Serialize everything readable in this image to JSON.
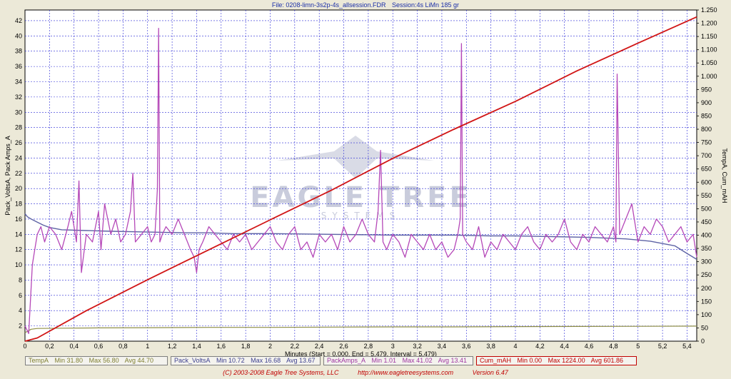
{
  "title": {
    "file": "File: 0208-limn-3s2p-4s_allsession.FDR",
    "session": "Session:4s LiMn 185 gr"
  },
  "colors": {
    "plot_bg": "#ffffff",
    "grid": "#2b2bd6",
    "temp": "#8f8f46",
    "volts": "#5e63a5",
    "amps": "#b548b8",
    "mah": "#d11515",
    "watermark": "#c9ccdc"
  },
  "chart_data": {
    "type": "line",
    "title": "",
    "xlabel": "Minutes (Start = 0.000, End = 5.479, Interval = 5.479)",
    "ylabel": "Pack_VoltsA, Pack Amps_A",
    "y2label": "TempA, Cum_mAH",
    "xlim": [
      0,
      5.479
    ],
    "ylim": [
      0,
      43.4
    ],
    "y2lim": [
      0,
      1250
    ],
    "grid": true,
    "x_ticks": [
      "0",
      "0,2",
      "0,4",
      "0,6",
      "0,8",
      "1",
      "1,2",
      "1,4",
      "1,6",
      "1,8",
      "2",
      "2,2",
      "2,4",
      "2,6",
      "2,8",
      "3",
      "3,2",
      "3,4",
      "3,6",
      "3,8",
      "4",
      "4,2",
      "4,4",
      "4,6",
      "4,8",
      "5",
      "5,2",
      "5,4"
    ],
    "y_ticks": [
      "2",
      "4",
      "6",
      "8",
      "10",
      "12",
      "14",
      "16",
      "18",
      "20",
      "22",
      "24",
      "26",
      "28",
      "30",
      "32",
      "34",
      "36",
      "38",
      "40",
      "42"
    ],
    "y2_ticks": [
      "0",
      "50",
      "100",
      "150",
      "200",
      "250",
      "300",
      "350",
      "400",
      "450",
      "500",
      "550",
      "600",
      "650",
      "700",
      "750",
      "800",
      "850",
      "900",
      "950",
      "1.000",
      "1.050",
      "1.100",
      "1.150",
      "1.200",
      "1.250"
    ],
    "series": [
      {
        "name": "TempA",
        "axis": "right",
        "x": [
          0,
          0.03,
          0.05,
          0.1,
          0.3,
          0.6,
          1,
          1.5,
          2,
          2.5,
          3,
          3.5,
          4,
          4.5,
          5,
          5.479
        ],
        "values": [
          32,
          40,
          45,
          48,
          49,
          50,
          51,
          52,
          52,
          53,
          54,
          54,
          55,
          55.5,
          56,
          56.8
        ]
      },
      {
        "name": "Pack_VoltsA",
        "axis": "left",
        "x": [
          0,
          0.02,
          0.05,
          0.1,
          0.15,
          0.2,
          0.3,
          0.5,
          0.7,
          1,
          1.3,
          1.5,
          1.7,
          2,
          2.5,
          3,
          3.5,
          3.8,
          4,
          4.3,
          4.6,
          4.9,
          5.1,
          5.3,
          5.4,
          5.479
        ],
        "values": [
          16.7,
          16.3,
          16,
          15.6,
          15.2,
          14.9,
          14.6,
          14.5,
          14.4,
          14.3,
          14.2,
          14.2,
          14.1,
          14.1,
          14,
          13.9,
          13.9,
          13.8,
          13.8,
          13.7,
          13.6,
          13.4,
          13.1,
          12.5,
          11.5,
          10.72
        ]
      },
      {
        "name": "PackAmps_A",
        "axis": "left",
        "x": [
          0,
          0.03,
          0.06,
          0.08,
          0.1,
          0.13,
          0.16,
          0.2,
          0.25,
          0.3,
          0.35,
          0.38,
          0.42,
          0.44,
          0.46,
          0.5,
          0.55,
          0.6,
          0.62,
          0.65,
          0.7,
          0.74,
          0.78,
          0.82,
          0.86,
          0.88,
          0.9,
          0.95,
          1,
          1.03,
          1.06,
          1.08,
          1.09,
          1.1,
          1.12,
          1.15,
          1.2,
          1.25,
          1.3,
          1.35,
          1.38,
          1.4,
          1.42,
          1.45,
          1.5,
          1.55,
          1.6,
          1.65,
          1.7,
          1.75,
          1.8,
          1.85,
          1.9,
          1.95,
          2,
          2.05,
          2.1,
          2.15,
          2.2,
          2.25,
          2.3,
          2.35,
          2.4,
          2.45,
          2.5,
          2.55,
          2.6,
          2.65,
          2.7,
          2.75,
          2.8,
          2.85,
          2.88,
          2.9,
          2.92,
          2.95,
          3,
          3.05,
          3.1,
          3.15,
          3.2,
          3.25,
          3.3,
          3.35,
          3.4,
          3.45,
          3.5,
          3.53,
          3.55,
          3.56,
          3.57,
          3.6,
          3.65,
          3.7,
          3.75,
          3.8,
          3.85,
          3.9,
          3.95,
          4,
          4.05,
          4.1,
          4.15,
          4.2,
          4.25,
          4.3,
          4.35,
          4.4,
          4.45,
          4.5,
          4.55,
          4.6,
          4.65,
          4.7,
          4.75,
          4.8,
          4.82,
          4.83,
          4.85,
          4.9,
          4.95,
          5,
          5.05,
          5.1,
          5.15,
          5.2,
          5.25,
          5.3,
          5.35,
          5.4,
          5.45,
          5.479
        ],
        "values": [
          2,
          1,
          10,
          12,
          14,
          15,
          13,
          15,
          14,
          12,
          15,
          17,
          13,
          21,
          9,
          14,
          13,
          17,
          12,
          18,
          14,
          16,
          13,
          14,
          17,
          22,
          13,
          14,
          15,
          13,
          14,
          20,
          41,
          13,
          14,
          15,
          14,
          16,
          14,
          12,
          11,
          9,
          12,
          13,
          15,
          14,
          13,
          12,
          14,
          13,
          14,
          12,
          13,
          14,
          15,
          13,
          12,
          14,
          15,
          12,
          13,
          11,
          14,
          13,
          14,
          12,
          15,
          13,
          14,
          16,
          14,
          13,
          17,
          25,
          13,
          12,
          14,
          13,
          11,
          14,
          13,
          12,
          14,
          12,
          13,
          11,
          12,
          14,
          16,
          39,
          14,
          13,
          12,
          15,
          11,
          13,
          12,
          14,
          13,
          12,
          14,
          15,
          13,
          12,
          14,
          13,
          14,
          16,
          13,
          12,
          14,
          13,
          15,
          14,
          13,
          15,
          13,
          35,
          14,
          16,
          18,
          13,
          15,
          14,
          16,
          15,
          13,
          14,
          15,
          13,
          14,
          11
        ]
      },
      {
        "name": "Cum_mAH",
        "axis": "right",
        "x": [
          0,
          0.1,
          0.5,
          1,
          1.5,
          2,
          2.5,
          3,
          3.5,
          4,
          4.5,
          5,
          5.479
        ],
        "values": [
          0,
          12,
          115,
          232,
          345,
          458,
          570,
          690,
          800,
          905,
          1020,
          1125,
          1224
        ]
      }
    ],
    "watermark": {
      "brand": "EAGLE TREE",
      "sub": "SYSTEMS"
    }
  },
  "legend": [
    {
      "name": "TempA",
      "min": "Min 31.80",
      "max": "Max 56.80",
      "avg": "Avg 44.70",
      "color": "#7f7f30"
    },
    {
      "name": "Pack_VoltsA",
      "min": "Min 10.72",
      "max": "Max 16.68",
      "avg": "Avg 13.67",
      "color": "#3c3f8f"
    },
    {
      "name": "PackAmps_A",
      "min": "Min 1.01",
      "max": "Max 41.02",
      "avg": "Avg 13.41",
      "color": "#9e34a1"
    },
    {
      "name": "Cum_mAH",
      "min": "Min 0.00",
      "max": "Max 1224.00",
      "avg": "Avg 601.86",
      "color": "#c00000"
    }
  ],
  "footer": {
    "copyright": "(C) 2003-2008 Eagle Tree Systems, LLC",
    "url": "http://www.eagletreesystems.com",
    "version": "Version 6.47"
  }
}
